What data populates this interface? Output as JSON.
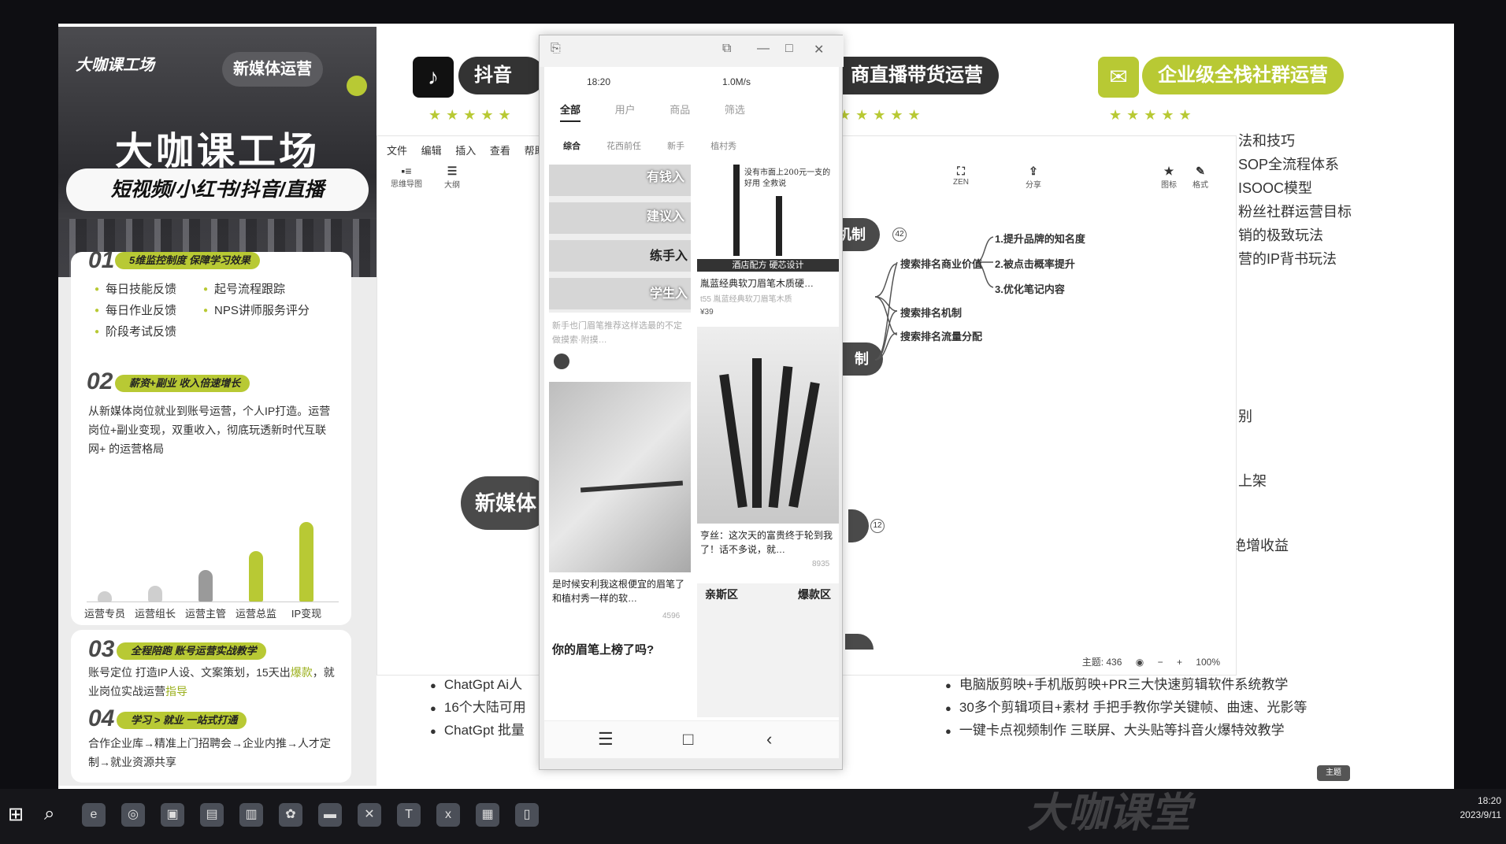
{
  "promo": {
    "brand": "大咖课工场",
    "tag": "新媒体运营",
    "title": "大咖课工场",
    "subtitle": "短视频/小红书/抖音/直播",
    "sections": [
      {
        "num": "01",
        "title": "5维监控制度 保障学习效果"
      },
      {
        "num": "02",
        "title": "薪资+副业 收入倍速增长"
      },
      {
        "num": "03",
        "title": "全程陪跑 账号运营实战教学"
      },
      {
        "num": "04",
        "title": "学习 > 就业 一站式打通"
      }
    ],
    "bullets": [
      "每日技能反馈",
      "起号流程跟踪",
      "每日作业反馈",
      "NPS讲师服务评分",
      "阶段考试反馈"
    ],
    "sec2_text": "从新媒体岗位就业到账号运营，个人IP打造。运营岗位+副业变现，双重收入，彻底玩透新时代互联网+ 的运营格局",
    "sec3_text_a": "账号定位 打造IP人设、文案策划，15天出",
    "sec3_hl_a": "爆款",
    "sec3_text_b": "，就业岗位实战运营",
    "sec3_hl_b": "指导",
    "sec4_text": "合作企业库→精准上门招聘会→企业内推→人才定制→就业资源共享",
    "chart": {
      "labels": [
        "运营专员",
        "运营组长",
        "运营主管",
        "运营总监",
        "IP变现"
      ],
      "levels": [
        0.12,
        0.18,
        0.36,
        0.58,
        0.92
      ]
    }
  },
  "headers": {
    "douyin": "抖音短视",
    "live": "商直播带货运营",
    "wechat": "企业级全栈社群运营",
    "stars": "★★★★★"
  },
  "right_list": [
    "法和技巧",
    "SOP全流程体系",
    "ISOOC模型",
    "粉丝社群运营目标",
    "销的极致玩法",
    "营的IP背书玩法"
  ],
  "right_frag": [
    "别",
    "上架",
    "绝增收益"
  ],
  "mindmap": {
    "menu": [
      "文件",
      "编辑",
      "插入",
      "查看",
      "帮助"
    ],
    "tools_left": [
      {
        "icon": "▪≡",
        "label": "思维导图"
      },
      {
        "icon": "☰",
        "label": "大纲"
      }
    ],
    "tools_right": [
      {
        "icon": "⛶",
        "label": "ZEN"
      },
      {
        "icon": "⇪",
        "label": "分享"
      },
      {
        "icon": "★",
        "label": "图标"
      },
      {
        "icon": "✎",
        "label": "格式"
      }
    ],
    "node_top": "机制",
    "node_mid": "制",
    "node_left": "新媒体",
    "badge1": "42",
    "badge2": "12",
    "branch": "搜索排名商业价值",
    "leaves": [
      "1.提升品牌的知名度",
      "2.被点击概率提升",
      "3.优化笔记内容"
    ],
    "branch2": "搜索排名机制",
    "branch3": "搜索排名流量分配",
    "status": {
      "topics": "主题: 436",
      "zoom": "100%"
    }
  },
  "bottom_left": [
    "ChatGpt Ai人",
    "16个大陆可用",
    "ChatGpt 批量"
  ],
  "bottom_right": [
    "电脑版剪映+手机版剪映+PR三大快速剪辑软件系统教学",
    "30多个剪辑项目+素材 手把手教你学关键帧、曲速、光影等",
    "一键卡点视频制作 三联屏、大头贴等抖音火爆特效教学"
  ],
  "phone": {
    "time": "18:20",
    "net": "1.0M/s",
    "tabs1": [
      "全部",
      "用户",
      "商品",
      "筛选"
    ],
    "tabs2": [
      "综合",
      "花西前任",
      "新手",
      "植村秀"
    ],
    "img_labels": [
      "有钱入",
      "建议入",
      "练手入",
      "学生入"
    ],
    "post1_title": "新手也门眉笔推荐这样选最的不定做摸索·附摸…",
    "post2_hdr": "没有市面上200元一支的好用 全救说",
    "post2_band": "酒店配方 硬芯设计",
    "post2_title": "胤蓝经典软刀眉笔木质硬…",
    "post2_sub": "t55 胤蓝经典软刀眉笔木质",
    "post2_price": "¥39",
    "post3_title": "亨丝：这次天的富贵终于轮到我了！话不多说，就…",
    "post3_meta": "8935",
    "post4_title": "是时候安利我这根便宜的眉笔了 和植村秀一样的软…",
    "post4_meta": "4596",
    "post5_title": "你的眉笔上榜了吗?",
    "zone_a": "亲斯区",
    "zone_b": "爆款区"
  },
  "taskbar": {
    "time": "18:20",
    "date": "2023/9/11",
    "watermark": "大咖课堂"
  },
  "tag_small": "主题",
  "colors": {
    "accent": "#b8c934",
    "dark": "#4a4a4a"
  }
}
